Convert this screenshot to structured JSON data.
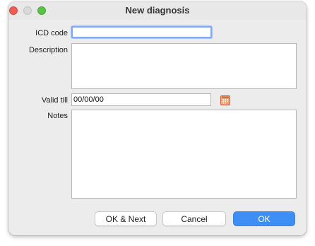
{
  "window": {
    "title": "New diagnosis"
  },
  "form": {
    "icd_code": {
      "label": "ICD code",
      "value": ""
    },
    "description": {
      "label": "Description",
      "value": ""
    },
    "valid_till": {
      "label": "Valid till",
      "value": "00/00/00"
    },
    "notes": {
      "label": "Notes",
      "value": ""
    }
  },
  "buttons": {
    "ok_next": "OK & Next",
    "cancel": "Cancel",
    "ok": "OK"
  },
  "icons": {
    "close": "close-circle",
    "minimize": "minimize-circle",
    "zoom": "zoom-circle",
    "calendar": "calendar-icon"
  },
  "colors": {
    "accent": "#3e8ff5",
    "close": "#ee5d54",
    "zoom": "#5ac249",
    "calendar": "#f4a37a"
  }
}
